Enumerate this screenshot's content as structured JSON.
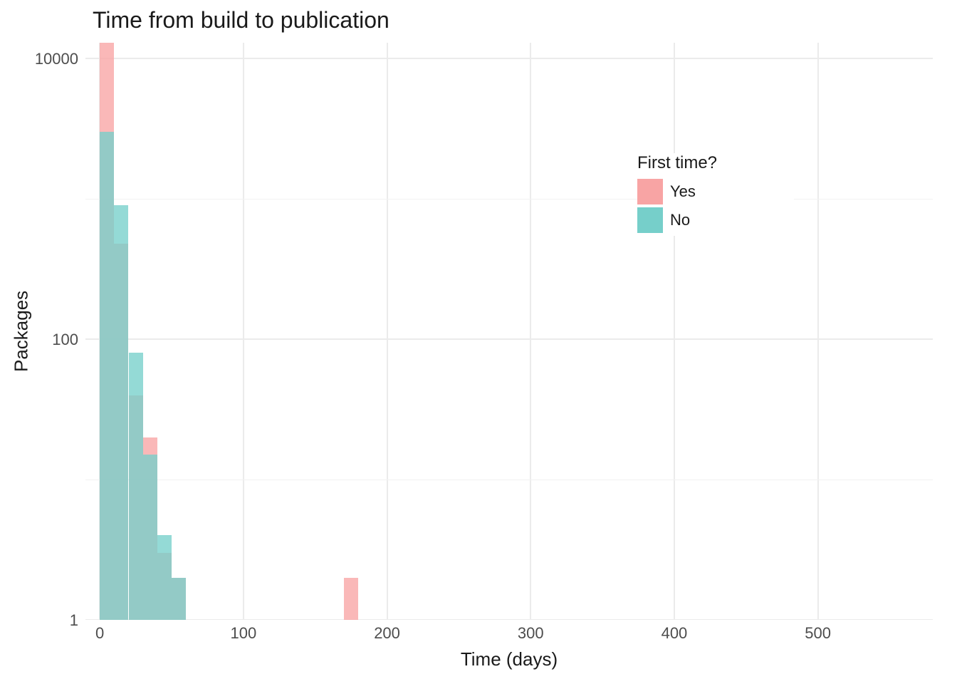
{
  "chart_data": {
    "type": "bar",
    "title": "Time from build to publication",
    "xlabel": "Time (days)",
    "ylabel": "Packages",
    "xlim": [
      -10,
      580
    ],
    "ylim": [
      1,
      13000
    ],
    "y_scale": "log10",
    "x_ticks": [
      0,
      100,
      200,
      300,
      400,
      500
    ],
    "y_ticks": [
      1,
      100,
      10000
    ],
    "bin_width": 10,
    "legend": {
      "title": "First time?",
      "entries": [
        "Yes",
        "No"
      ]
    },
    "colors": {
      "Yes": "#f8a4a4",
      "No": "#76cfca"
    },
    "series": [
      {
        "name": "Yes",
        "bins": [
          {
            "x_start": 0,
            "count": 13000
          },
          {
            "x_start": 10,
            "count": 480
          },
          {
            "x_start": 20,
            "count": 40
          },
          {
            "x_start": 30,
            "count": 20
          },
          {
            "x_start": 40,
            "count": 3
          },
          {
            "x_start": 50,
            "count": 2
          },
          {
            "x_start": 170,
            "count": 2
          }
        ]
      },
      {
        "name": "No",
        "bins": [
          {
            "x_start": 0,
            "count": 3000
          },
          {
            "x_start": 10,
            "count": 900
          },
          {
            "x_start": 20,
            "count": 80
          },
          {
            "x_start": 30,
            "count": 15
          },
          {
            "x_start": 40,
            "count": 4
          },
          {
            "x_start": 50,
            "count": 2
          }
        ]
      }
    ]
  }
}
